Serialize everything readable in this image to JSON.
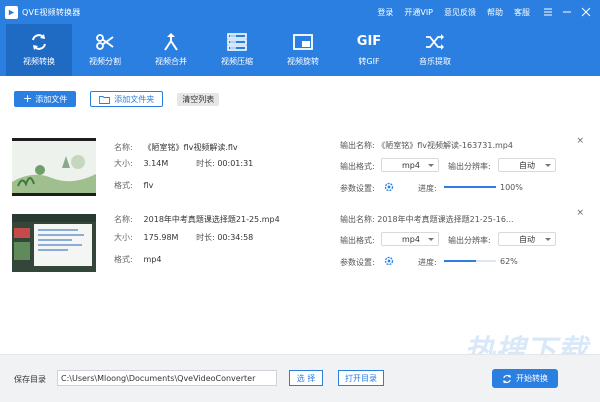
{
  "titlebar": {
    "title": "QVE视频转换器",
    "links": [
      "登录",
      "开通VIP",
      "意见反馈",
      "帮助",
      "客服"
    ]
  },
  "toolbar": {
    "tools": [
      {
        "label": "视频转换",
        "icon": "refresh-icon",
        "active": true
      },
      {
        "label": "视频分割",
        "icon": "scissors-icon",
        "active": false
      },
      {
        "label": "视频合并",
        "icon": "merge-icon",
        "active": false
      },
      {
        "label": "视频压缩",
        "icon": "compress-icon",
        "active": false
      },
      {
        "label": "视频旋转",
        "icon": "rotate-icon",
        "active": false
      },
      {
        "label": "转GIF",
        "icon": "gif-icon",
        "active": false,
        "glyph": "GIF"
      },
      {
        "label": "音乐提取",
        "icon": "shuffle-icon",
        "active": false
      }
    ]
  },
  "actions": {
    "add_file": "添加文件",
    "add_folder": "添加文件夹",
    "clear_list": "清空列表"
  },
  "labels": {
    "name": "名称:",
    "size": "大小:",
    "duration": "时长:",
    "format": "格式:",
    "out_name": "输出名称:",
    "out_format": "输出格式:",
    "out_resolution": "输出分辨率:",
    "params": "参数设置:",
    "progress": "进度:"
  },
  "files": [
    {
      "name": "《陋室铭》flv视频解读.flv",
      "size": "3.14M",
      "duration": "00:01:31",
      "format": "flv",
      "out_name": "《陋室铭》flv视频解读-163731.mp4",
      "out_format": "mp4",
      "out_resolution": "自动",
      "progress": 100,
      "progress_text": "100%"
    },
    {
      "name": "2018年中考真题课选择题21-25.mp4",
      "size": "175.98M",
      "duration": "00:34:58",
      "format": "mp4",
      "out_name": "2018年中考真题课选择题21-25-16...",
      "out_format": "mp4",
      "out_resolution": "自动",
      "progress": 62,
      "progress_text": "62%"
    }
  ],
  "bottom": {
    "save_label": "保存目录",
    "save_path": "C:\\Users\\Mloong\\Documents\\QveVideoConverter",
    "choose": "选 择",
    "open_dir": "打开目录",
    "start": "开始转换"
  },
  "watermark": "热搜下载",
  "colors": {
    "accent": "#2b7fe0",
    "toolbar_active": "#1f6bc4"
  }
}
